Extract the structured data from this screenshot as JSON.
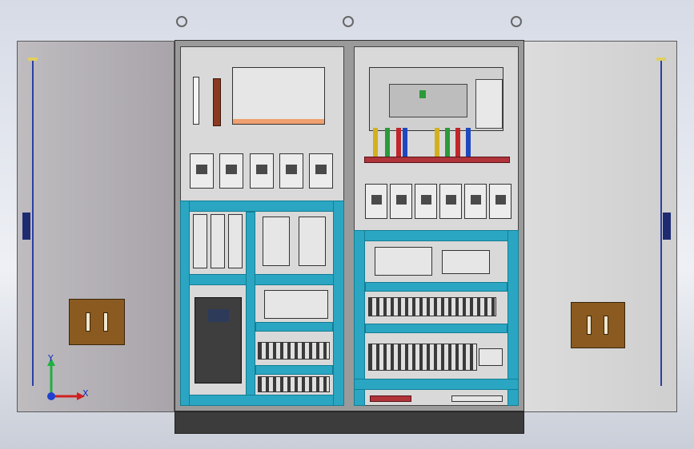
{
  "axes": {
    "y_label": "Y",
    "x_label": "X"
  },
  "colors": {
    "duct": "#2aa6c2",
    "busbar": "#b0343a",
    "handle": "#8a5a20",
    "axis_x": "#d02020",
    "axis_y": "#20b040",
    "axis_z": "#2040d0"
  },
  "icons": {
    "triad": "coordinate-triad-icon",
    "lifting": "lifting-eye-icon"
  }
}
